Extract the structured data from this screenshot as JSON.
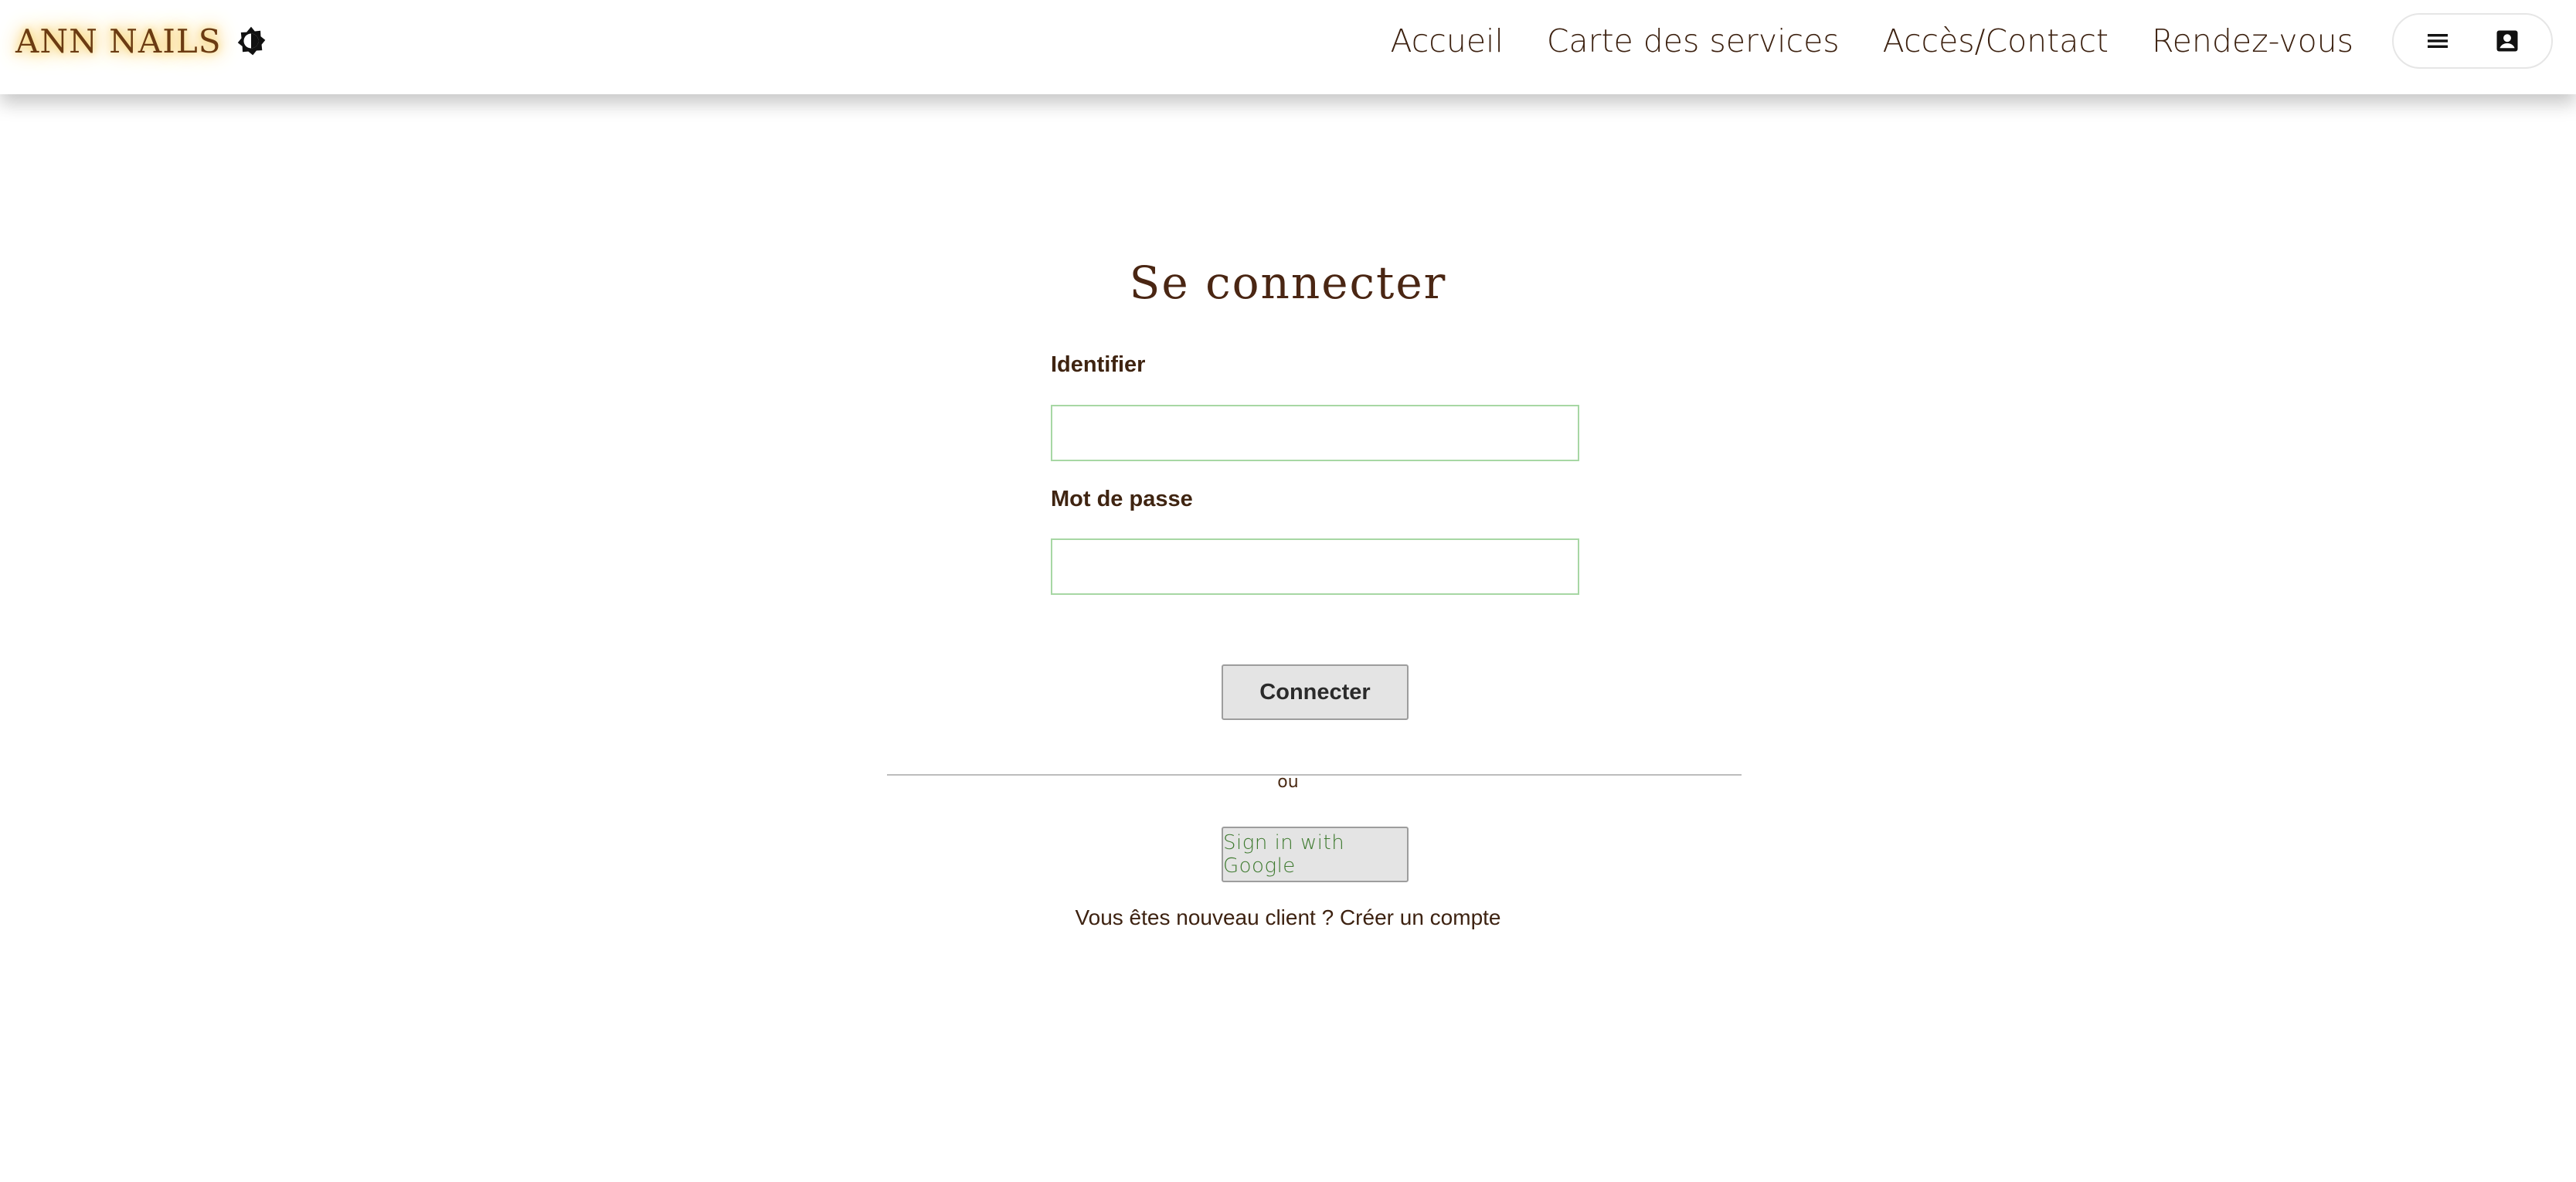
{
  "header": {
    "brand": "ANN NAILS",
    "theme_toggle_icon": "contrast-icon",
    "nav": [
      {
        "label": "Accueil"
      },
      {
        "label": "Carte des services"
      },
      {
        "label": "Accès/Contact"
      },
      {
        "label": "Rendez-vous"
      }
    ],
    "menu_icon": "hamburger-menu-icon",
    "account_icon": "account-box-icon"
  },
  "login": {
    "title": "Se connecter",
    "identifier_label": "Identifier",
    "identifier_value": "",
    "password_label": "Mot de passe",
    "password_value": "",
    "submit_label": "Connecter",
    "or_text": "ou",
    "google_label": "Sign in with Google",
    "new_client_text": "Vous êtes nouveau client ?",
    "create_account_link": "Créer un compte"
  },
  "colors": {
    "text_brown": "#3d2211",
    "brand_glow": "#f4c14b",
    "input_border": "#a7d7a4",
    "google_text": "#3e7a2f",
    "button_bg": "#e4e4e4"
  }
}
